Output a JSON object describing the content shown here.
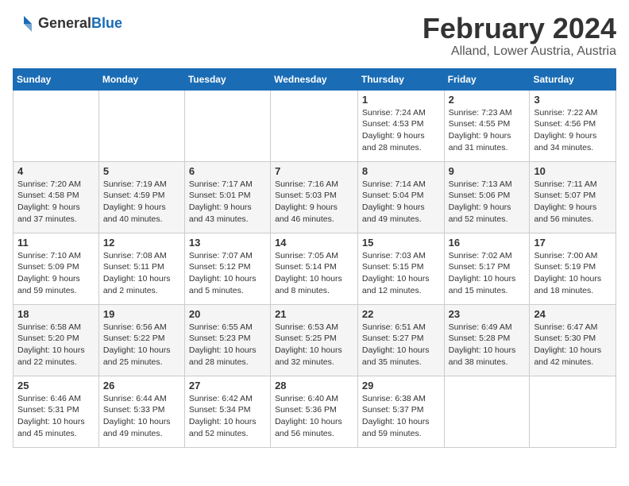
{
  "logo": {
    "line1": "General",
    "line2": "Blue"
  },
  "title": "February 2024",
  "subtitle": "Alland, Lower Austria, Austria",
  "days_of_week": [
    "Sunday",
    "Monday",
    "Tuesday",
    "Wednesday",
    "Thursday",
    "Friday",
    "Saturday"
  ],
  "weeks": [
    [
      {
        "day": "",
        "info": ""
      },
      {
        "day": "",
        "info": ""
      },
      {
        "day": "",
        "info": ""
      },
      {
        "day": "",
        "info": ""
      },
      {
        "day": "1",
        "info": "Sunrise: 7:24 AM\nSunset: 4:53 PM\nDaylight: 9 hours and 28 minutes."
      },
      {
        "day": "2",
        "info": "Sunrise: 7:23 AM\nSunset: 4:55 PM\nDaylight: 9 hours and 31 minutes."
      },
      {
        "day": "3",
        "info": "Sunrise: 7:22 AM\nSunset: 4:56 PM\nDaylight: 9 hours and 34 minutes."
      }
    ],
    [
      {
        "day": "4",
        "info": "Sunrise: 7:20 AM\nSunset: 4:58 PM\nDaylight: 9 hours and 37 minutes."
      },
      {
        "day": "5",
        "info": "Sunrise: 7:19 AM\nSunset: 4:59 PM\nDaylight: 9 hours and 40 minutes."
      },
      {
        "day": "6",
        "info": "Sunrise: 7:17 AM\nSunset: 5:01 PM\nDaylight: 9 hours and 43 minutes."
      },
      {
        "day": "7",
        "info": "Sunrise: 7:16 AM\nSunset: 5:03 PM\nDaylight: 9 hours and 46 minutes."
      },
      {
        "day": "8",
        "info": "Sunrise: 7:14 AM\nSunset: 5:04 PM\nDaylight: 9 hours and 49 minutes."
      },
      {
        "day": "9",
        "info": "Sunrise: 7:13 AM\nSunset: 5:06 PM\nDaylight: 9 hours and 52 minutes."
      },
      {
        "day": "10",
        "info": "Sunrise: 7:11 AM\nSunset: 5:07 PM\nDaylight: 9 hours and 56 minutes."
      }
    ],
    [
      {
        "day": "11",
        "info": "Sunrise: 7:10 AM\nSunset: 5:09 PM\nDaylight: 9 hours and 59 minutes."
      },
      {
        "day": "12",
        "info": "Sunrise: 7:08 AM\nSunset: 5:11 PM\nDaylight: 10 hours and 2 minutes."
      },
      {
        "day": "13",
        "info": "Sunrise: 7:07 AM\nSunset: 5:12 PM\nDaylight: 10 hours and 5 minutes."
      },
      {
        "day": "14",
        "info": "Sunrise: 7:05 AM\nSunset: 5:14 PM\nDaylight: 10 hours and 8 minutes."
      },
      {
        "day": "15",
        "info": "Sunrise: 7:03 AM\nSunset: 5:15 PM\nDaylight: 10 hours and 12 minutes."
      },
      {
        "day": "16",
        "info": "Sunrise: 7:02 AM\nSunset: 5:17 PM\nDaylight: 10 hours and 15 minutes."
      },
      {
        "day": "17",
        "info": "Sunrise: 7:00 AM\nSunset: 5:19 PM\nDaylight: 10 hours and 18 minutes."
      }
    ],
    [
      {
        "day": "18",
        "info": "Sunrise: 6:58 AM\nSunset: 5:20 PM\nDaylight: 10 hours and 22 minutes."
      },
      {
        "day": "19",
        "info": "Sunrise: 6:56 AM\nSunset: 5:22 PM\nDaylight: 10 hours and 25 minutes."
      },
      {
        "day": "20",
        "info": "Sunrise: 6:55 AM\nSunset: 5:23 PM\nDaylight: 10 hours and 28 minutes."
      },
      {
        "day": "21",
        "info": "Sunrise: 6:53 AM\nSunset: 5:25 PM\nDaylight: 10 hours and 32 minutes."
      },
      {
        "day": "22",
        "info": "Sunrise: 6:51 AM\nSunset: 5:27 PM\nDaylight: 10 hours and 35 minutes."
      },
      {
        "day": "23",
        "info": "Sunrise: 6:49 AM\nSunset: 5:28 PM\nDaylight: 10 hours and 38 minutes."
      },
      {
        "day": "24",
        "info": "Sunrise: 6:47 AM\nSunset: 5:30 PM\nDaylight: 10 hours and 42 minutes."
      }
    ],
    [
      {
        "day": "25",
        "info": "Sunrise: 6:46 AM\nSunset: 5:31 PM\nDaylight: 10 hours and 45 minutes."
      },
      {
        "day": "26",
        "info": "Sunrise: 6:44 AM\nSunset: 5:33 PM\nDaylight: 10 hours and 49 minutes."
      },
      {
        "day": "27",
        "info": "Sunrise: 6:42 AM\nSunset: 5:34 PM\nDaylight: 10 hours and 52 minutes."
      },
      {
        "day": "28",
        "info": "Sunrise: 6:40 AM\nSunset: 5:36 PM\nDaylight: 10 hours and 56 minutes."
      },
      {
        "day": "29",
        "info": "Sunrise: 6:38 AM\nSunset: 5:37 PM\nDaylight: 10 hours and 59 minutes."
      },
      {
        "day": "",
        "info": ""
      },
      {
        "day": "",
        "info": ""
      }
    ]
  ]
}
